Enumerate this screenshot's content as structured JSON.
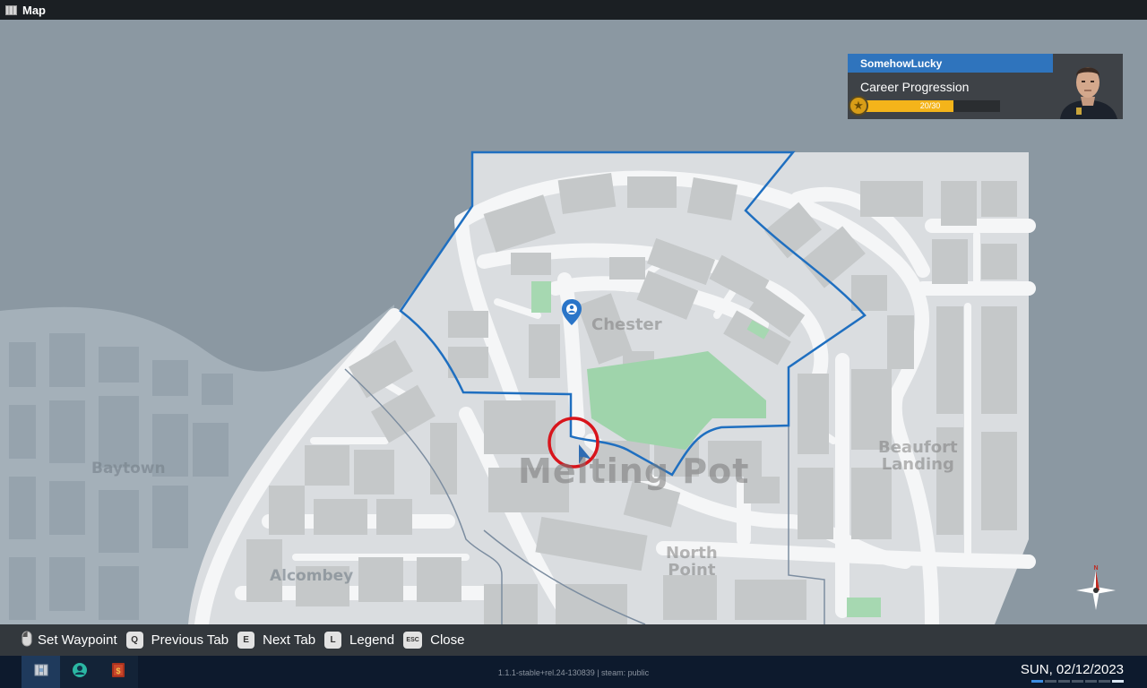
{
  "window": {
    "title": "Map",
    "icon": "map-icon"
  },
  "map": {
    "districts": [
      {
        "id": "chester",
        "label": "Chester"
      },
      {
        "id": "melting-pot",
        "label": "Melting Pot"
      },
      {
        "id": "beaufort",
        "label": "Beaufort\nLanding"
      },
      {
        "id": "north-point",
        "label": "North\nPoint"
      },
      {
        "id": "baytown",
        "label": "Baytown"
      },
      {
        "id": "alcombey",
        "label": "Alcombey"
      }
    ],
    "compass": {
      "north_label": "N",
      "icon": "compass-icon"
    },
    "markers": {
      "waypoint_icon": "location-pin-icon",
      "player_icon": "player-arrow-icon"
    },
    "colors": {
      "water": "#8b98a2",
      "land": "#dadde0",
      "building": "#c3c6c7",
      "park": "#9fd4ab",
      "boundary": "#1f6fc0",
      "highlight": "#d8151c"
    }
  },
  "career": {
    "username": "SomehowLucky",
    "title": "Career Progression",
    "progress_text": "20/30",
    "progress_fraction": 0.667,
    "badge_icon": "star-badge-icon",
    "avatar_icon": "officer-avatar-icon",
    "colors": {
      "header": "#2f74bd",
      "bar": "#f4b41a"
    }
  },
  "hints": [
    {
      "key": "mouse",
      "label": "Set Waypoint"
    },
    {
      "key": "Q",
      "label": "Previous Tab"
    },
    {
      "key": "E",
      "label": "Next Tab"
    },
    {
      "key": "L",
      "label": "Legend"
    },
    {
      "key": "ESC",
      "label": "Close"
    }
  ],
  "taskbar": {
    "apps": [
      {
        "name": "map-app",
        "icon": "map-icon",
        "active": true
      },
      {
        "name": "contacts-app",
        "icon": "person-icon",
        "active": false
      },
      {
        "name": "book-app",
        "icon": "book-icon",
        "active": false
      }
    ],
    "version": "1.1.1-stable+rel.24-130839 | steam: public",
    "date": "SUN, 02/12/2023"
  }
}
